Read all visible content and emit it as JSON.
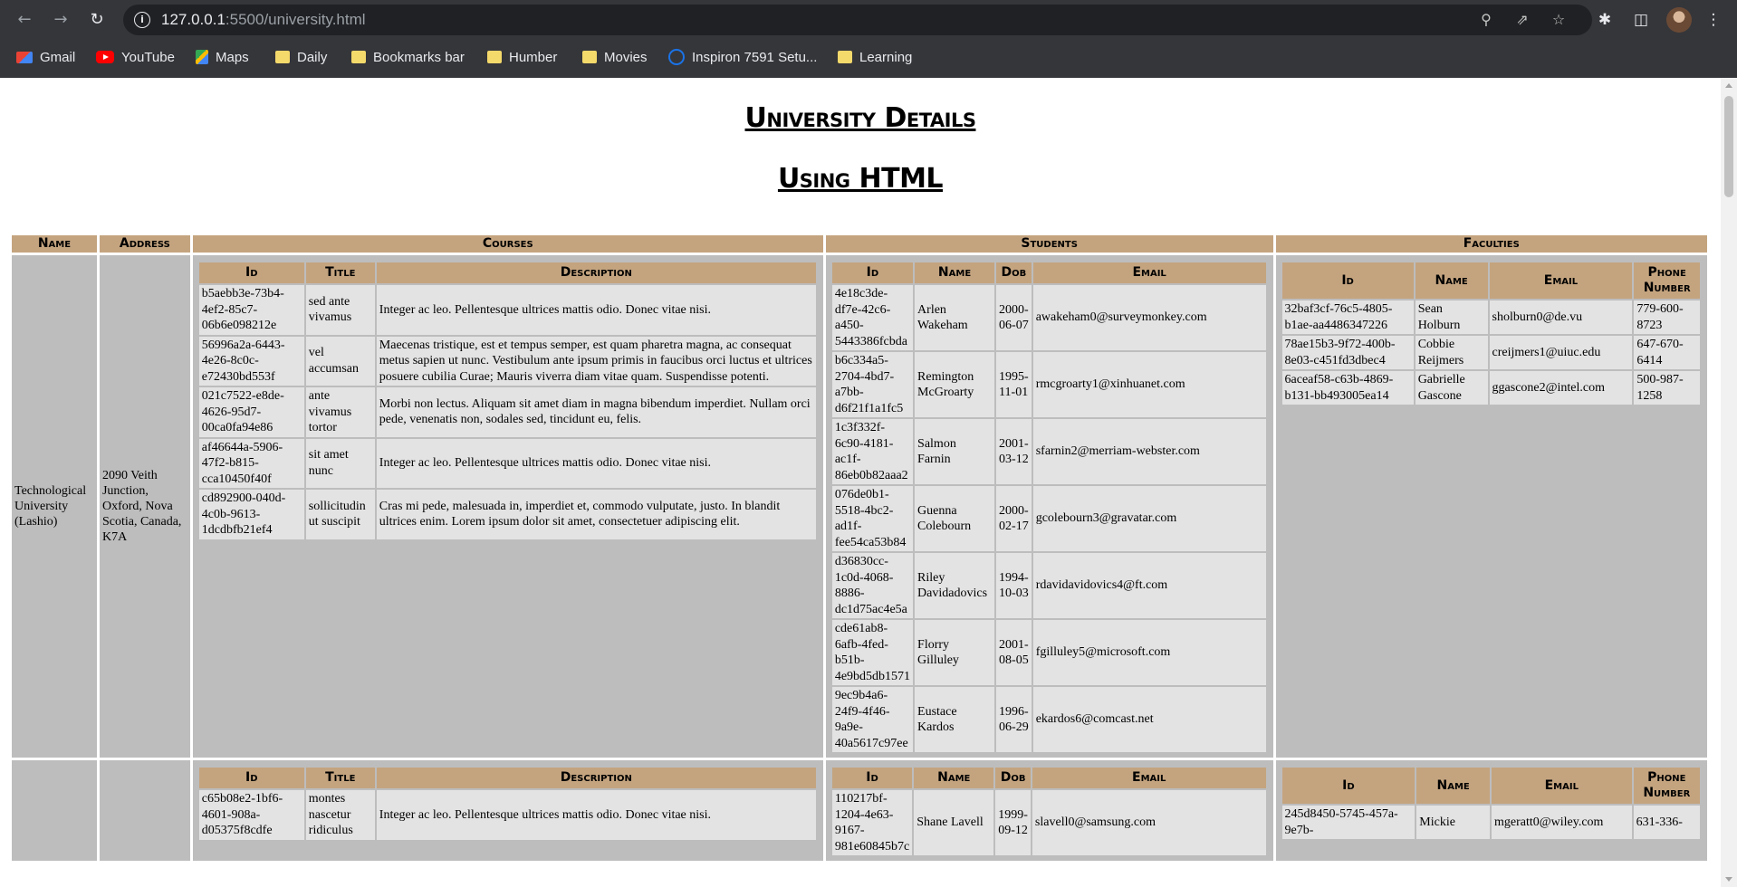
{
  "browser": {
    "url_host": "127.0.0.1",
    "url_path": ":5500/university.html",
    "bookmarks": [
      {
        "label": "Gmail",
        "icon": "gmail-icon"
      },
      {
        "label": "YouTube",
        "icon": "youtube-icon"
      },
      {
        "label": "Maps",
        "icon": "maps-icon"
      },
      {
        "label": "Daily",
        "icon": "folder-icon"
      },
      {
        "label": "Bookmarks bar",
        "icon": "folder-icon"
      },
      {
        "label": "Humber",
        "icon": "folder-icon"
      },
      {
        "label": "Movies",
        "icon": "folder-icon"
      },
      {
        "label": "Inspiron 7591 Setu...",
        "icon": "dell-icon"
      },
      {
        "label": "Learning",
        "icon": "folder-icon"
      }
    ]
  },
  "page": {
    "title": "University Details",
    "subtitle": "Using HTML",
    "headers": {
      "name": "Name",
      "address": "Address",
      "courses": "Courses",
      "students": "Students",
      "faculties": "Faculties"
    },
    "course_headers": {
      "id": "Id",
      "title": "Title",
      "description": "Description"
    },
    "student_headers": {
      "id": "Id",
      "name": "Name",
      "dob": "Dob",
      "email": "Email"
    },
    "faculty_headers": {
      "id": "Id",
      "name": "Name",
      "email": "Email",
      "phone": "Phone Number"
    },
    "universities": [
      {
        "name": "Technological University (Lashio)",
        "address": "2090 Veith Junction, Oxford, Nova Scotia, Canada, K7A",
        "courses": [
          {
            "id": "b5aebb3e-73b4-4ef2-85c7-06b6e098212e",
            "title": "sed ante vivamus",
            "description": "Integer ac leo. Pellentesque ultrices mattis odio. Donec vitae nisi."
          },
          {
            "id": "56996a2a-6443-4e26-8c0c-e72430bd553f",
            "title": "vel accumsan",
            "description": "Maecenas tristique, est et tempus semper, est quam pharetra magna, ac consequat metus sapien ut nunc. Vestibulum ante ipsum primis in faucibus orci luctus et ultrices posuere cubilia Curae; Mauris viverra diam vitae quam. Suspendisse potenti."
          },
          {
            "id": "021c7522-e8de-4626-95d7-00ca0fa94e86",
            "title": "ante vivamus tortor",
            "description": "Morbi non lectus. Aliquam sit amet diam in magna bibendum imperdiet. Nullam orci pede, venenatis non, sodales sed, tincidunt eu, felis."
          },
          {
            "id": "af46644a-5906-47f2-b815-cca10450f40f",
            "title": "sit amet nunc",
            "description": "Integer ac leo. Pellentesque ultrices mattis odio. Donec vitae nisi."
          },
          {
            "id": "cd892900-040d-4c0b-9613-1dcdbfb21ef4",
            "title": "sollicitudin ut suscipit",
            "description": "Cras mi pede, malesuada in, imperdiet et, commodo vulputate, justo. In blandit ultrices enim. Lorem ipsum dolor sit amet, consectetuer adipiscing elit."
          }
        ],
        "students": [
          {
            "id": "4e18c3de-df7e-42c6-a450-5443386fcbda",
            "name": "Arlen Wakeham",
            "dob": "2000-06-07",
            "email": "awakeham0@surveymonkey.com"
          },
          {
            "id": "b6c334a5-2704-4bd7-a7bb-d6f21f1a1fc5",
            "name": "Remington McGroarty",
            "dob": "1995-11-01",
            "email": "rmcgroarty1@xinhuanet.com"
          },
          {
            "id": "1c3f332f-6c90-4181-ac1f-86eb0b82aaa2",
            "name": "Salmon Farnin",
            "dob": "2001-03-12",
            "email": "sfarnin2@merriam-webster.com"
          },
          {
            "id": "076de0b1-5518-4bc2-ad1f-fee54ca53b84",
            "name": "Guenna Colebourn",
            "dob": "2000-02-17",
            "email": "gcolebourn3@gravatar.com"
          },
          {
            "id": "d36830cc-1c0d-4068-8886-dc1d75ac4e5a",
            "name": "Riley Davidadovics",
            "dob": "1994-10-03",
            "email": "rdavidavidovics4@ft.com"
          },
          {
            "id": "cde61ab8-6afb-4fed-b51b-4e9bd5db1571",
            "name": "Florry Gilluley",
            "dob": "2001-08-05",
            "email": "fgilluley5@microsoft.com"
          },
          {
            "id": "9ec9b4a6-24f9-4f46-9a9e-40a5617c97ee",
            "name": "Eustace Kardos",
            "dob": "1996-06-29",
            "email": "ekardos6@comcast.net"
          }
        ],
        "faculties": [
          {
            "id": "32baf3cf-76c5-4805-b1ae-aa4486347226",
            "name": "Sean Holburn",
            "email": "sholburn0@de.vu",
            "phone": "779-600-8723"
          },
          {
            "id": "78ae15b3-9f72-400b-8e03-c451fd3dbec4",
            "name": "Cobbie Reijmers",
            "email": "creijmers1@uiuc.edu",
            "phone": "647-670-6414"
          },
          {
            "id": "6aceaf58-c63b-4869-b131-bb493005ea14",
            "name": "Gabrielle Gascone",
            "email": "ggascone2@intel.com",
            "phone": "500-987-1258"
          }
        ]
      },
      {
        "name": "",
        "address": "",
        "courses": [
          {
            "id": "c65b08e2-1bf6-4601-908a-d05375f8cdfe",
            "title": "montes nascetur ridiculus",
            "description": "Integer ac leo. Pellentesque ultrices mattis odio. Donec vitae nisi."
          }
        ],
        "students": [
          {
            "id": "110217bf-1204-4e63-9167-981e60845b7c",
            "name": "Shane Lavell",
            "dob": "1999-09-12",
            "email": "slavell0@samsung.com"
          }
        ],
        "faculties": [
          {
            "id": "245d8450-5745-457a-9e7b-",
            "name": "Mickie",
            "email": "mgeratt0@wiley.com",
            "phone": "631-336-"
          }
        ]
      }
    ]
  }
}
